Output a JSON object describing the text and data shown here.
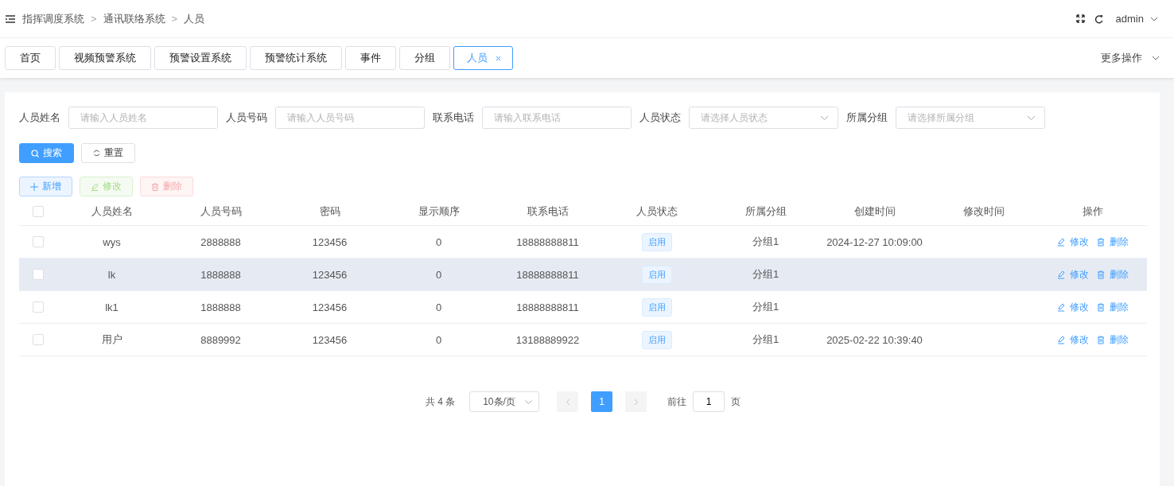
{
  "breadcrumb": [
    {
      "kind": "item",
      "text": "指挥调度系统"
    },
    {
      "kind": "separator",
      "text": ">"
    },
    {
      "kind": "item",
      "text": "通讯联络系统"
    },
    {
      "kind": "separator",
      "text": ">"
    },
    {
      "kind": "item",
      "text": "人员"
    }
  ],
  "header": {
    "user": "admin"
  },
  "tabs": [
    {
      "label": "首页",
      "selected": false,
      "closable": false
    },
    {
      "label": "视频预警系统",
      "selected": false,
      "closable": false
    },
    {
      "label": "预警设置系统",
      "selected": false,
      "closable": false
    },
    {
      "label": "预警统计系统",
      "selected": false,
      "closable": false
    },
    {
      "label": "事件",
      "selected": false,
      "closable": false
    },
    {
      "label": "分组",
      "selected": false,
      "closable": false
    },
    {
      "label": "人员",
      "selected": true,
      "closable": true
    }
  ],
  "more_actions": "更多操作",
  "filters": [
    {
      "label": "人员姓名",
      "kind": "input",
      "placeholder": "请输入人员姓名"
    },
    {
      "label": "人员号码",
      "kind": "input",
      "placeholder": "请输入人员号码"
    },
    {
      "label": "联系电话",
      "kind": "input",
      "placeholder": "请输入联系电话"
    },
    {
      "label": "人员状态",
      "kind": "select",
      "placeholder": "请选择人员状态"
    },
    {
      "label": "所属分组",
      "kind": "select",
      "placeholder": "请选择所属分组"
    }
  ],
  "search_button": "搜索",
  "reset_button": "重置",
  "toolbar": [
    {
      "label": "新增",
      "kind": "primary",
      "disabled": false
    },
    {
      "label": "修改",
      "kind": "success",
      "disabled": true
    },
    {
      "label": "删除",
      "kind": "danger",
      "disabled": true
    }
  ],
  "table": {
    "header_checked": false,
    "columns": [
      "人员姓名",
      "人员号码",
      "密码",
      "显示顺序",
      "联系电话",
      "人员状态",
      "所属分组",
      "创建时间",
      "修改时间",
      "操作"
    ],
    "rows": [
      {
        "checked": false,
        "highlighted": false,
        "name": "wys",
        "number": "2888888",
        "password": "123456",
        "order": "0",
        "phone": "18888888811",
        "status": "启用",
        "group": "分组1",
        "created": "2024-12-27 10:09:00",
        "edit": "修改",
        "delete": "删除"
      },
      {
        "checked": false,
        "highlighted": true,
        "name": "lk",
        "number": "1888888",
        "password": "123456",
        "order": "0",
        "phone": "18888888811",
        "status": "启用",
        "group": "分组1",
        "edit": "修改",
        "delete": "删除"
      },
      {
        "checked": false,
        "highlighted": false,
        "name": "lk1",
        "number": "1888888",
        "password": "123456",
        "order": "0",
        "phone": "18888888811",
        "status": "启用",
        "group": "分组1",
        "edit": "修改",
        "delete": "删除"
      },
      {
        "checked": false,
        "highlighted": false,
        "name": "用户",
        "number": "8889992",
        "password": "123456",
        "order": "0",
        "phone": "13188889922",
        "status": "启用",
        "group": "分组1",
        "created": "2025-02-22 10:39:40",
        "edit": "修改",
        "delete": "删除"
      }
    ]
  },
  "pagination": {
    "total": "共 4 条",
    "page_size": "10条/页",
    "prev_disabled": true,
    "next_disabled": true,
    "pages": [
      {
        "label": "1",
        "selected": true
      }
    ],
    "goto_label": "前往",
    "goto_value": "1",
    "goto_unit": "页"
  }
}
